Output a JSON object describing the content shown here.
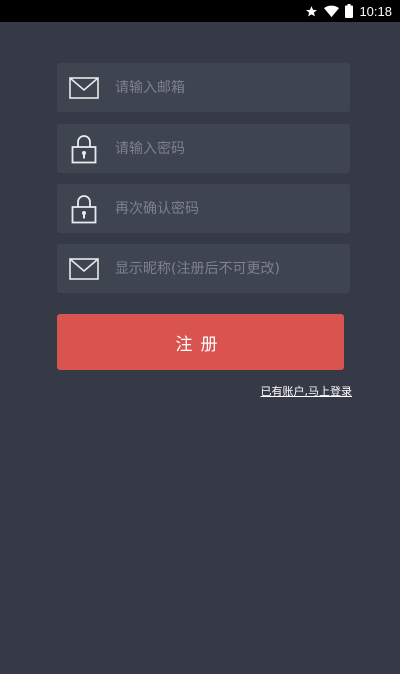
{
  "status_bar": {
    "time": "10:18",
    "icons": [
      "star-icon",
      "wifi-icon",
      "battery-icon"
    ]
  },
  "form": {
    "email": {
      "placeholder": "请输入邮箱",
      "value": "",
      "icon": "mail-icon"
    },
    "password": {
      "placeholder": "请输入密码",
      "value": "",
      "icon": "lock-icon"
    },
    "confirm_password": {
      "placeholder": "再次确认密码",
      "value": "",
      "icon": "lock-icon"
    },
    "nickname": {
      "placeholder": "显示昵称(注册后不可更改)",
      "value": "",
      "icon": "mail-icon"
    }
  },
  "register_button": {
    "label": "注册"
  },
  "login_link": {
    "label": "已有账户,马上登录"
  },
  "colors": {
    "background": "#353a46",
    "field_background": "#3f4451",
    "accent": "#d9544f",
    "status_bar": "#000000"
  }
}
